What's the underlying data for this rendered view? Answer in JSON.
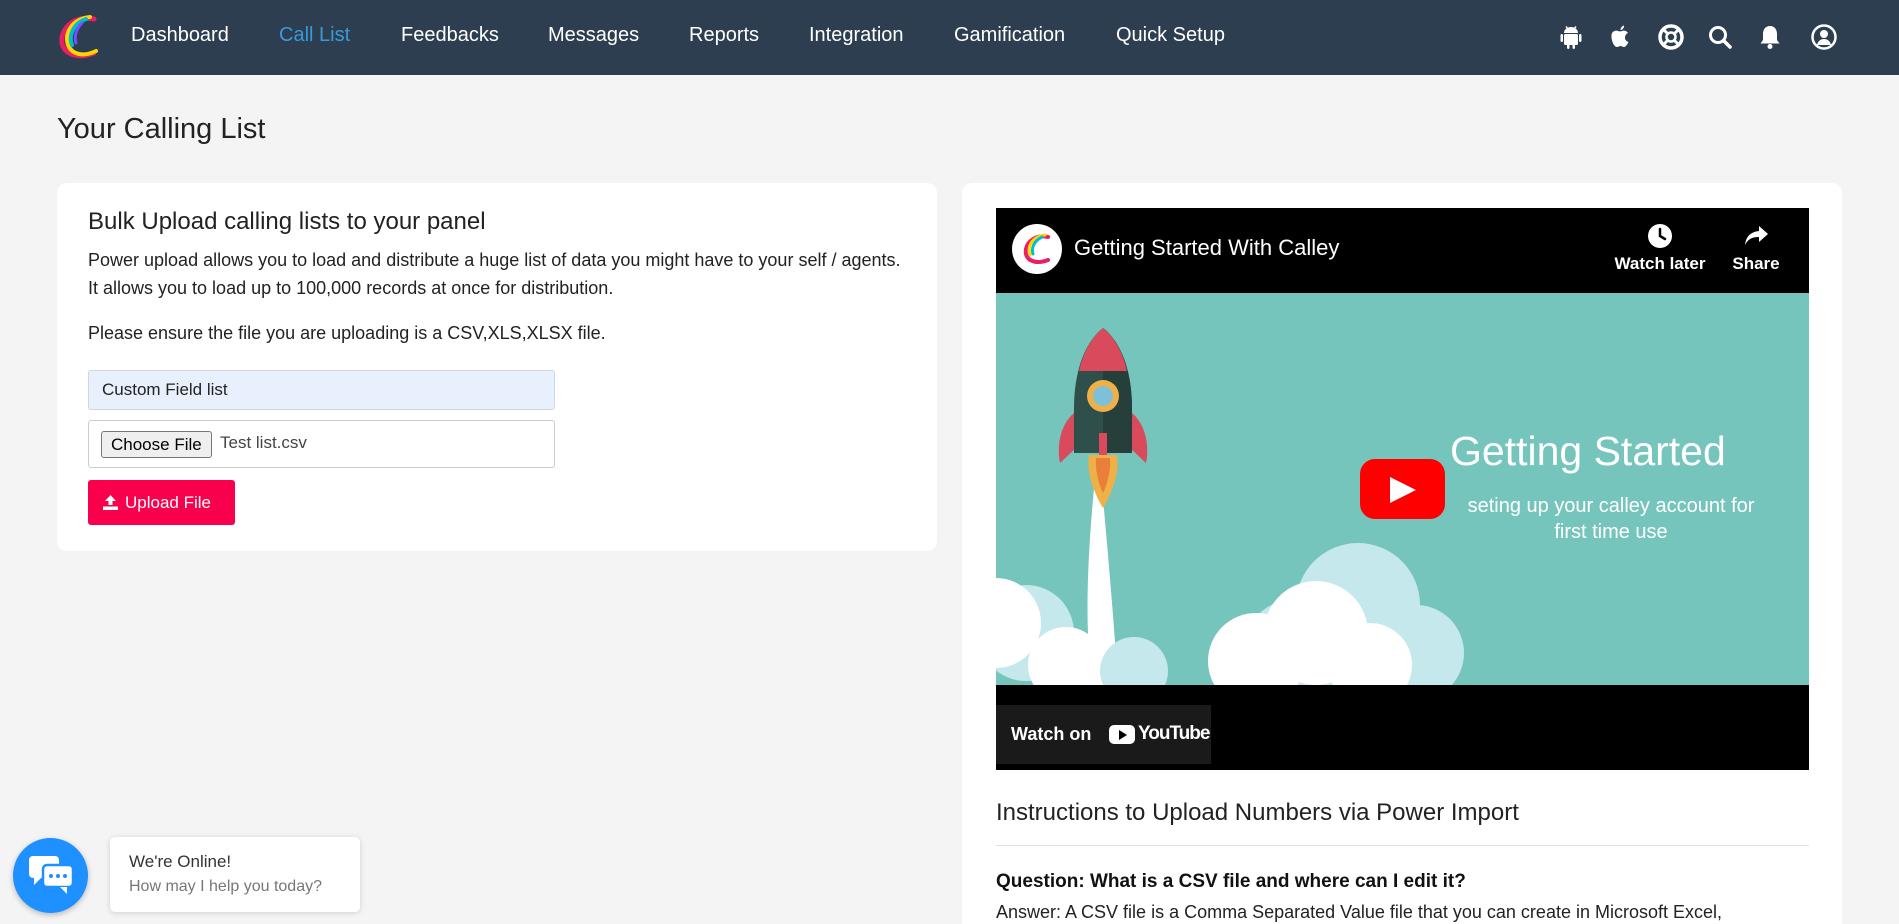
{
  "nav": {
    "items": [
      {
        "label": "Dashboard",
        "active": false
      },
      {
        "label": "Call List",
        "active": true
      },
      {
        "label": "Feedbacks",
        "active": false
      },
      {
        "label": "Messages",
        "active": false
      },
      {
        "label": "Reports",
        "active": false
      },
      {
        "label": "Integration",
        "active": false
      },
      {
        "label": "Gamification",
        "active": false
      },
      {
        "label": "Quick Setup",
        "active": false
      }
    ],
    "icons": [
      "android-icon",
      "apple-icon",
      "help-icon",
      "search-icon",
      "bell-icon",
      "user-icon"
    ],
    "bg_color": "#2c3e50",
    "active_color": "#3a9ad9"
  },
  "page": {
    "title": "Your Calling List"
  },
  "upload_card": {
    "heading": "Bulk Upload calling lists to your panel",
    "description": "Power upload allows you to load and distribute a huge list of data you might have to your self / agents. It allows you to load up to 100,000 records at once for distribution.",
    "note": "Please ensure the file you are uploading is a CSV,XLS,XLSX file.",
    "custom_field_value": "Custom Field list",
    "choose_file_label": "Choose File",
    "file_name": "Test list.csv",
    "upload_button": "Upload File",
    "upload_color": "#f8004c"
  },
  "video": {
    "title": "Getting Started With Calley",
    "watch_later": "Watch later",
    "share": "Share",
    "thumb_headline": "Getting Started",
    "thumb_sub": "seting up your calley account for first time use",
    "watch_on": "Watch on",
    "youtube": "YouTube"
  },
  "instructions": {
    "title": "Instructions to Upload Numbers via Power Import",
    "question": "Question: What is a CSV file and where can I edit it?",
    "answer": "Answer: A CSV file is a Comma Separated Value file that you can create in Microsoft Excel,"
  },
  "chat": {
    "status": "We're Online!",
    "prompt": "How may I help you today?",
    "color": "#1e90ff"
  }
}
